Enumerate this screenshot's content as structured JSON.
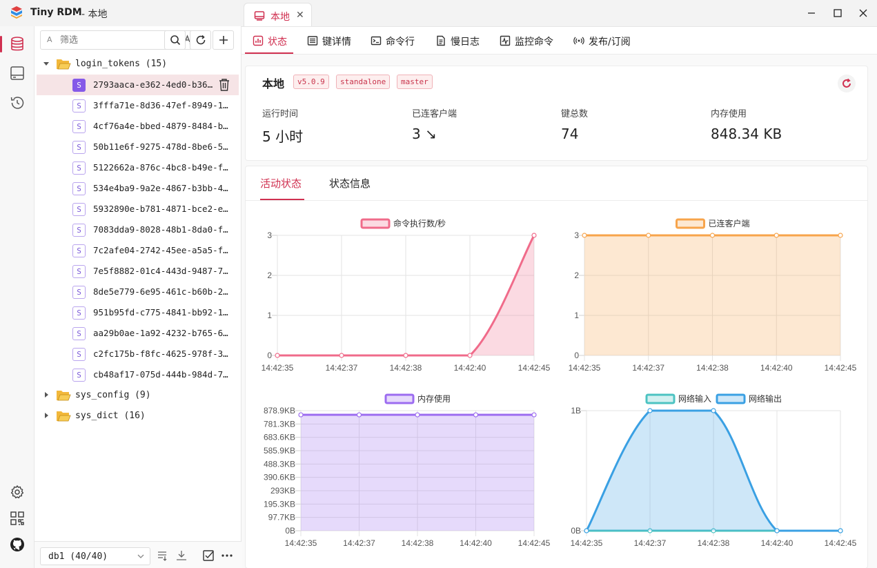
{
  "app": {
    "title": "Tiny RDM",
    "subtitle": "- 本地"
  },
  "window_tab": {
    "label": "本地",
    "close": "✕"
  },
  "sidebar": {
    "filter": {
      "prefix": "A",
      "placeholder": "筛选",
      "value": ""
    },
    "tree": [
      {
        "type": "folder",
        "label": "login_tokens (15)",
        "expanded": true
      },
      {
        "type": "key",
        "badge": "S",
        "label": "2793aaca-e362-4ed0-b36…",
        "selected": true
      },
      {
        "type": "key",
        "badge": "S",
        "label": "3fffa71e-8d36-47ef-8949-1…"
      },
      {
        "type": "key",
        "badge": "S",
        "label": "4cf76a4e-bbed-4879-8484-b…"
      },
      {
        "type": "key",
        "badge": "S",
        "label": "50b11e6f-9275-478d-8be6-5…"
      },
      {
        "type": "key",
        "badge": "S",
        "label": "5122662a-876c-4bc8-b49e-f…"
      },
      {
        "type": "key",
        "badge": "S",
        "label": "534e4ba9-9a2e-4867-b3bb-4…"
      },
      {
        "type": "key",
        "badge": "S",
        "label": "5932890e-b781-4871-bce2-e…"
      },
      {
        "type": "key",
        "badge": "S",
        "label": "7083dda9-8028-48b1-8da0-f…"
      },
      {
        "type": "key",
        "badge": "S",
        "label": "7c2afe04-2742-45ee-a5a5-f…"
      },
      {
        "type": "key",
        "badge": "S",
        "label": "7e5f8882-01c4-443d-9487-7…"
      },
      {
        "type": "key",
        "badge": "S",
        "label": "8de5e779-6e95-461c-b60b-2…"
      },
      {
        "type": "key",
        "badge": "S",
        "label": "951b95fd-c775-4841-bb92-1…"
      },
      {
        "type": "key",
        "badge": "S",
        "label": "aa29b0ae-1a92-4232-b765-6…"
      },
      {
        "type": "key",
        "badge": "S",
        "label": "c2fc175b-f8fc-4625-978f-3…"
      },
      {
        "type": "key",
        "badge": "S",
        "label": "cb48af17-075d-444b-984d-7…"
      },
      {
        "type": "folder",
        "label": "sys_config (9)",
        "expanded": false
      },
      {
        "type": "folder",
        "label": "sys_dict (16)",
        "expanded": false
      }
    ],
    "db_select": {
      "value": "db1 (40/40)"
    }
  },
  "subtabs": [
    {
      "name": "status",
      "label": "状态",
      "icon": "status-chart-icon",
      "active": true
    },
    {
      "name": "key-detail",
      "label": "键详情",
      "icon": "key-detail-icon"
    },
    {
      "name": "cli",
      "label": "命令行",
      "icon": "terminal-icon"
    },
    {
      "name": "slowlog",
      "label": "慢日志",
      "icon": "slowlog-icon"
    },
    {
      "name": "monitor",
      "label": "监控命令",
      "icon": "monitor-icon"
    },
    {
      "name": "pubsub",
      "label": "发布/订阅",
      "icon": "broadcast-icon"
    }
  ],
  "server": {
    "name": "本地",
    "tags": [
      "v5.0.9",
      "standalone",
      "master"
    ],
    "stats": [
      {
        "label": "运行时间",
        "value": "5 小时"
      },
      {
        "label": "已连客户端",
        "value": "3 ↘"
      },
      {
        "label": "键总数",
        "value": "74"
      },
      {
        "label": "内存使用",
        "value": "848.34 KB"
      }
    ]
  },
  "activity_tabs": [
    {
      "label": "活动状态",
      "active": true
    },
    {
      "label": "状态信息"
    }
  ],
  "colors": {
    "accent": "#d03050",
    "pink": "#f06b8a",
    "orange": "#f7a44b",
    "purple": "#9c6cf0",
    "teal": "#4cc3c2",
    "blue": "#3aa0e3"
  },
  "chart_data": [
    {
      "type": "line",
      "x": [
        "14:42:35",
        "14:42:37",
        "14:42:38",
        "14:42:40",
        "14:42:45"
      ],
      "series": [
        {
          "name": "命令执行数/秒",
          "values": [
            0,
            0,
            0,
            0,
            3
          ],
          "color": "#f06b8a",
          "fill": "rgba(240,107,138,0.25)"
        }
      ],
      "yticks": [
        "0",
        "1",
        "2",
        "3"
      ],
      "ylim": [
        0,
        3
      ],
      "grid": true,
      "legend": "top-center"
    },
    {
      "type": "line",
      "x": [
        "14:42:35",
        "14:42:37",
        "14:42:38",
        "14:42:40",
        "14:42:45"
      ],
      "series": [
        {
          "name": "已连客户端",
          "values": [
            3,
            3,
            3,
            3,
            3
          ],
          "color": "#f7a44b",
          "fill": "rgba(247,164,75,0.25)"
        }
      ],
      "yticks": [
        "0",
        "1",
        "2",
        "3"
      ],
      "ylim": [
        0,
        3
      ],
      "grid": true,
      "legend": "top-center"
    },
    {
      "type": "line",
      "x": [
        "14:42:35",
        "14:42:37",
        "14:42:38",
        "14:42:40",
        "14:42:45"
      ],
      "series": [
        {
          "name": "内存使用",
          "values": [
            848.34,
            848.34,
            848.34,
            848.34,
            848.34
          ],
          "color": "#9c6cf0",
          "fill": "rgba(156,108,240,0.25)"
        }
      ],
      "yticks": [
        "0B",
        "97.7KB",
        "195.3KB",
        "293KB",
        "390.6KB",
        "488.3KB",
        "585.9KB",
        "683.6KB",
        "781.3KB",
        "878.9KB"
      ],
      "ylim": [
        0,
        878.9
      ],
      "yunit": "KB",
      "grid": true,
      "legend": "top-center"
    },
    {
      "type": "line",
      "x": [
        "14:42:35",
        "14:42:37",
        "14:42:38",
        "14:42:40",
        "14:42:45"
      ],
      "series": [
        {
          "name": "网络输入",
          "values": [
            0,
            0,
            0,
            0,
            0
          ],
          "color": "#4cc3c2",
          "fill": "rgba(76,195,194,0.25)"
        },
        {
          "name": "网络输出",
          "values": [
            0,
            1,
            1,
            0,
            0
          ],
          "color": "#3aa0e3",
          "fill": "rgba(58,160,227,0.25)"
        }
      ],
      "yticks": [
        "0B",
        "1B"
      ],
      "ylim": [
        0,
        1
      ],
      "grid": true,
      "legend": "top-center"
    }
  ]
}
